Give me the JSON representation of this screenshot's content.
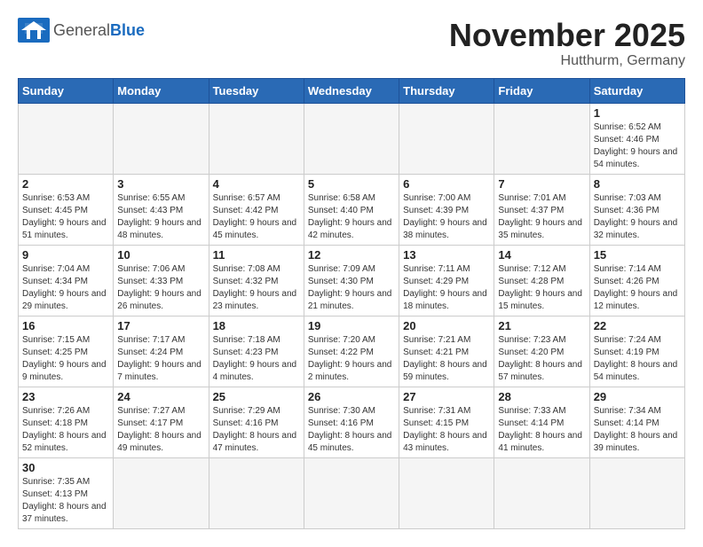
{
  "header": {
    "logo_text_general": "General",
    "logo_text_blue": "Blue",
    "month_title": "November 2025",
    "location": "Hutthurm, Germany"
  },
  "days_of_week": [
    "Sunday",
    "Monday",
    "Tuesday",
    "Wednesday",
    "Thursday",
    "Friday",
    "Saturday"
  ],
  "weeks": [
    [
      {
        "day": "",
        "info": ""
      },
      {
        "day": "",
        "info": ""
      },
      {
        "day": "",
        "info": ""
      },
      {
        "day": "",
        "info": ""
      },
      {
        "day": "",
        "info": ""
      },
      {
        "day": "",
        "info": ""
      },
      {
        "day": "1",
        "info": "Sunrise: 6:52 AM\nSunset: 4:46 PM\nDaylight: 9 hours and 54 minutes."
      }
    ],
    [
      {
        "day": "2",
        "info": "Sunrise: 6:53 AM\nSunset: 4:45 PM\nDaylight: 9 hours and 51 minutes."
      },
      {
        "day": "3",
        "info": "Sunrise: 6:55 AM\nSunset: 4:43 PM\nDaylight: 9 hours and 48 minutes."
      },
      {
        "day": "4",
        "info": "Sunrise: 6:57 AM\nSunset: 4:42 PM\nDaylight: 9 hours and 45 minutes."
      },
      {
        "day": "5",
        "info": "Sunrise: 6:58 AM\nSunset: 4:40 PM\nDaylight: 9 hours and 42 minutes."
      },
      {
        "day": "6",
        "info": "Sunrise: 7:00 AM\nSunset: 4:39 PM\nDaylight: 9 hours and 38 minutes."
      },
      {
        "day": "7",
        "info": "Sunrise: 7:01 AM\nSunset: 4:37 PM\nDaylight: 9 hours and 35 minutes."
      },
      {
        "day": "8",
        "info": "Sunrise: 7:03 AM\nSunset: 4:36 PM\nDaylight: 9 hours and 32 minutes."
      }
    ],
    [
      {
        "day": "9",
        "info": "Sunrise: 7:04 AM\nSunset: 4:34 PM\nDaylight: 9 hours and 29 minutes."
      },
      {
        "day": "10",
        "info": "Sunrise: 7:06 AM\nSunset: 4:33 PM\nDaylight: 9 hours and 26 minutes."
      },
      {
        "day": "11",
        "info": "Sunrise: 7:08 AM\nSunset: 4:32 PM\nDaylight: 9 hours and 23 minutes."
      },
      {
        "day": "12",
        "info": "Sunrise: 7:09 AM\nSunset: 4:30 PM\nDaylight: 9 hours and 21 minutes."
      },
      {
        "day": "13",
        "info": "Sunrise: 7:11 AM\nSunset: 4:29 PM\nDaylight: 9 hours and 18 minutes."
      },
      {
        "day": "14",
        "info": "Sunrise: 7:12 AM\nSunset: 4:28 PM\nDaylight: 9 hours and 15 minutes."
      },
      {
        "day": "15",
        "info": "Sunrise: 7:14 AM\nSunset: 4:26 PM\nDaylight: 9 hours and 12 minutes."
      }
    ],
    [
      {
        "day": "16",
        "info": "Sunrise: 7:15 AM\nSunset: 4:25 PM\nDaylight: 9 hours and 9 minutes."
      },
      {
        "day": "17",
        "info": "Sunrise: 7:17 AM\nSunset: 4:24 PM\nDaylight: 9 hours and 7 minutes."
      },
      {
        "day": "18",
        "info": "Sunrise: 7:18 AM\nSunset: 4:23 PM\nDaylight: 9 hours and 4 minutes."
      },
      {
        "day": "19",
        "info": "Sunrise: 7:20 AM\nSunset: 4:22 PM\nDaylight: 9 hours and 2 minutes."
      },
      {
        "day": "20",
        "info": "Sunrise: 7:21 AM\nSunset: 4:21 PM\nDaylight: 8 hours and 59 minutes."
      },
      {
        "day": "21",
        "info": "Sunrise: 7:23 AM\nSunset: 4:20 PM\nDaylight: 8 hours and 57 minutes."
      },
      {
        "day": "22",
        "info": "Sunrise: 7:24 AM\nSunset: 4:19 PM\nDaylight: 8 hours and 54 minutes."
      }
    ],
    [
      {
        "day": "23",
        "info": "Sunrise: 7:26 AM\nSunset: 4:18 PM\nDaylight: 8 hours and 52 minutes."
      },
      {
        "day": "24",
        "info": "Sunrise: 7:27 AM\nSunset: 4:17 PM\nDaylight: 8 hours and 49 minutes."
      },
      {
        "day": "25",
        "info": "Sunrise: 7:29 AM\nSunset: 4:16 PM\nDaylight: 8 hours and 47 minutes."
      },
      {
        "day": "26",
        "info": "Sunrise: 7:30 AM\nSunset: 4:16 PM\nDaylight: 8 hours and 45 minutes."
      },
      {
        "day": "27",
        "info": "Sunrise: 7:31 AM\nSunset: 4:15 PM\nDaylight: 8 hours and 43 minutes."
      },
      {
        "day": "28",
        "info": "Sunrise: 7:33 AM\nSunset: 4:14 PM\nDaylight: 8 hours and 41 minutes."
      },
      {
        "day": "29",
        "info": "Sunrise: 7:34 AM\nSunset: 4:14 PM\nDaylight: 8 hours and 39 minutes."
      }
    ],
    [
      {
        "day": "30",
        "info": "Sunrise: 7:35 AM\nSunset: 4:13 PM\nDaylight: 8 hours and 37 minutes."
      },
      {
        "day": "",
        "info": ""
      },
      {
        "day": "",
        "info": ""
      },
      {
        "day": "",
        "info": ""
      },
      {
        "day": "",
        "info": ""
      },
      {
        "day": "",
        "info": ""
      },
      {
        "day": "",
        "info": ""
      }
    ]
  ]
}
